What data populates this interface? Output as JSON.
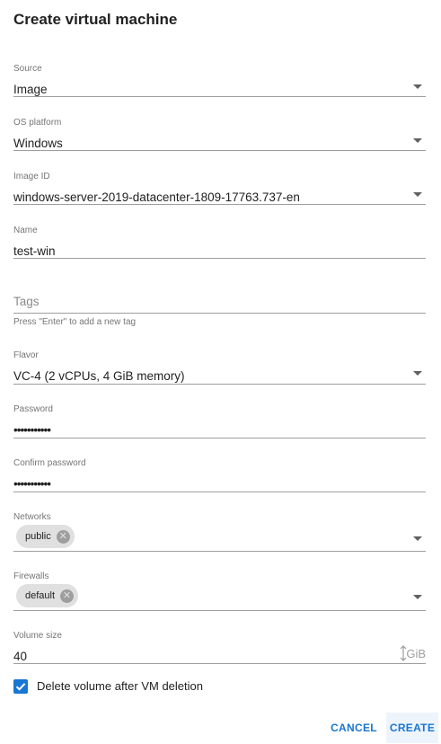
{
  "dialog": {
    "title": "Create virtual machine"
  },
  "fields": {
    "source": {
      "label": "Source",
      "value": "Image"
    },
    "os_platform": {
      "label": "OS platform",
      "value": "Windows"
    },
    "image_id": {
      "label": "Image ID",
      "value": "windows-server-2019-datacenter-1809-17763.737-en"
    },
    "name": {
      "label": "Name",
      "value": "test-win"
    },
    "tags": {
      "placeholder": "Tags",
      "hint": "Press \"Enter\" to add a new tag"
    },
    "flavor": {
      "label": "Flavor",
      "value": "VC-4 (2 vCPUs, 4 GiB memory)"
    },
    "password": {
      "label": "Password",
      "value": "•••••••••••"
    },
    "confirm_password": {
      "label": "Confirm password",
      "value": "•••••••••••"
    },
    "networks": {
      "label": "Networks",
      "chips": [
        "public"
      ]
    },
    "firewalls": {
      "label": "Firewalls",
      "chips": [
        "default"
      ]
    },
    "volume_size": {
      "label": "Volume size",
      "value": "40",
      "unit": "GiB"
    }
  },
  "delete_volume": {
    "label": "Delete volume after VM deletion",
    "checked": true
  },
  "actions": {
    "cancel": "CANCEL",
    "create": "CREATE"
  },
  "colors": {
    "accent": "#1976d2",
    "chip_bg": "#e0e0e0",
    "label": "#757575"
  }
}
